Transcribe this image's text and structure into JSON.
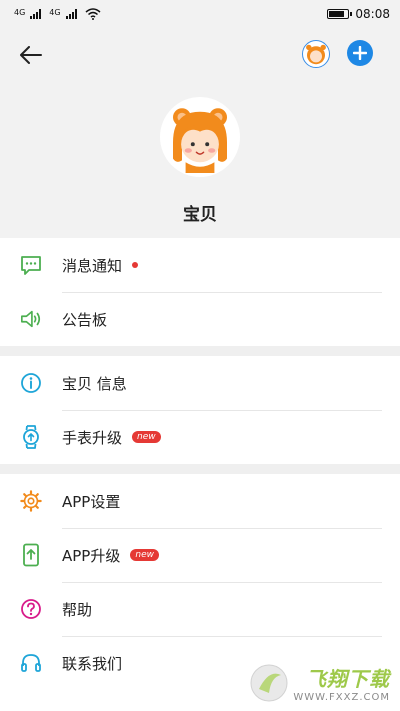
{
  "status_bar": {
    "signal1_label": "4G",
    "signal2_label": "4G",
    "battery_level": 0.9,
    "time": "08:08"
  },
  "header": {
    "back_icon": "arrow-left-icon",
    "add_icon": "plus-circle-icon",
    "profile_name": "宝贝"
  },
  "menu": {
    "group1": [
      {
        "label": "消息通知",
        "icon": "message-icon",
        "color": "#4caf50",
        "indicator": "dot"
      },
      {
        "label": "公告板",
        "icon": "speaker-icon",
        "color": "#4caf50"
      }
    ],
    "group2": [
      {
        "label": "宝贝 信息",
        "icon": "info-icon",
        "color": "#1ea5d8"
      },
      {
        "label": "手表升级",
        "icon": "watch-icon",
        "color": "#1ea5d8",
        "badge": "new"
      }
    ],
    "group3": [
      {
        "label": "APP设置",
        "icon": "gear-icon",
        "color": "#f28b1c"
      },
      {
        "label": "APP升级",
        "icon": "phone-upgrade-icon",
        "color": "#4caf50",
        "badge": "new"
      },
      {
        "label": "帮助",
        "icon": "help-icon",
        "color": "#d81b8a"
      },
      {
        "label": "联系我们",
        "icon": "headset-icon",
        "color": "#1ea5d8"
      }
    ]
  },
  "watermark": {
    "text": "飞翔下载",
    "url": "WWW.FXXZ.COM"
  }
}
